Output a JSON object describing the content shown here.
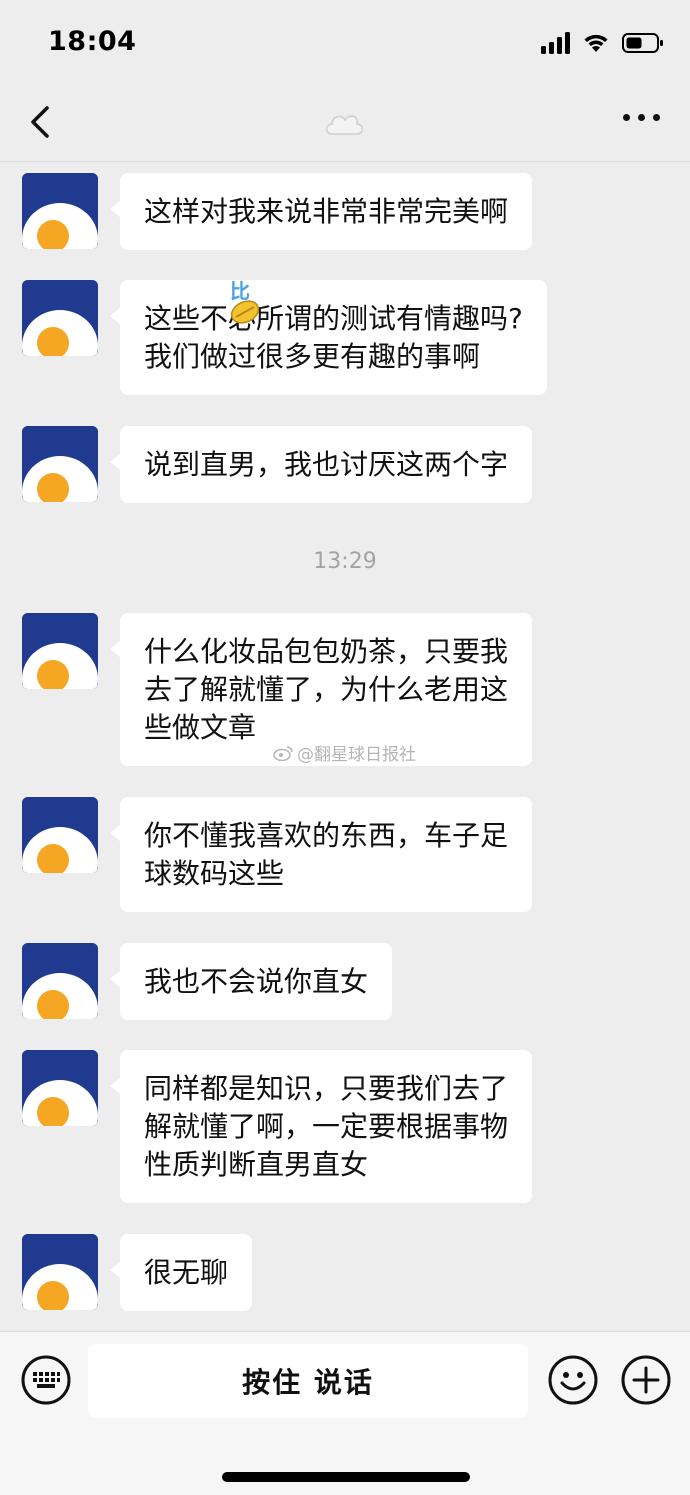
{
  "status_bar": {
    "time": "18:04",
    "icons": [
      "signal-icon",
      "wifi-icon",
      "battery-icon"
    ]
  },
  "nav": {
    "back_icon": "chevron-left-icon",
    "title_icon": "cloud-icon",
    "more_icon": "more-dots-icon"
  },
  "messages": [
    {
      "text": "这样对我来说非常非常完美啊"
    },
    {
      "text": "这些不必所谓的测试有情趣吗?\n我们做过很多更有趣的事啊",
      "sticker": "比"
    },
    {
      "text": "说到直男，我也讨厌这两个字"
    },
    {
      "text": "什么化妆品包包奶茶，只要我\n去了解就懂了，为什么老用这\n些做文章"
    },
    {
      "text": "你不懂我喜欢的东西，车子足\n球数码这些"
    },
    {
      "text": "我也不会说你直女"
    },
    {
      "text": "同样都是知识，只要我们去了\n解就懂了啊，一定要根据事物\n性质判断直男直女"
    },
    {
      "text": "很无聊"
    }
  ],
  "time_separator": "13:29",
  "watermark": "@翻星球日报社",
  "input_bar": {
    "keyboard_icon": "keyboard-icon",
    "voice_label": "按住 说话",
    "emoji_icon": "emoji-icon",
    "plus_icon": "plus-icon"
  },
  "colors": {
    "background": "#ededed",
    "bubble": "#ffffff",
    "avatar_blue": "#1f3a8f",
    "avatar_yolk": "#f5a623"
  }
}
